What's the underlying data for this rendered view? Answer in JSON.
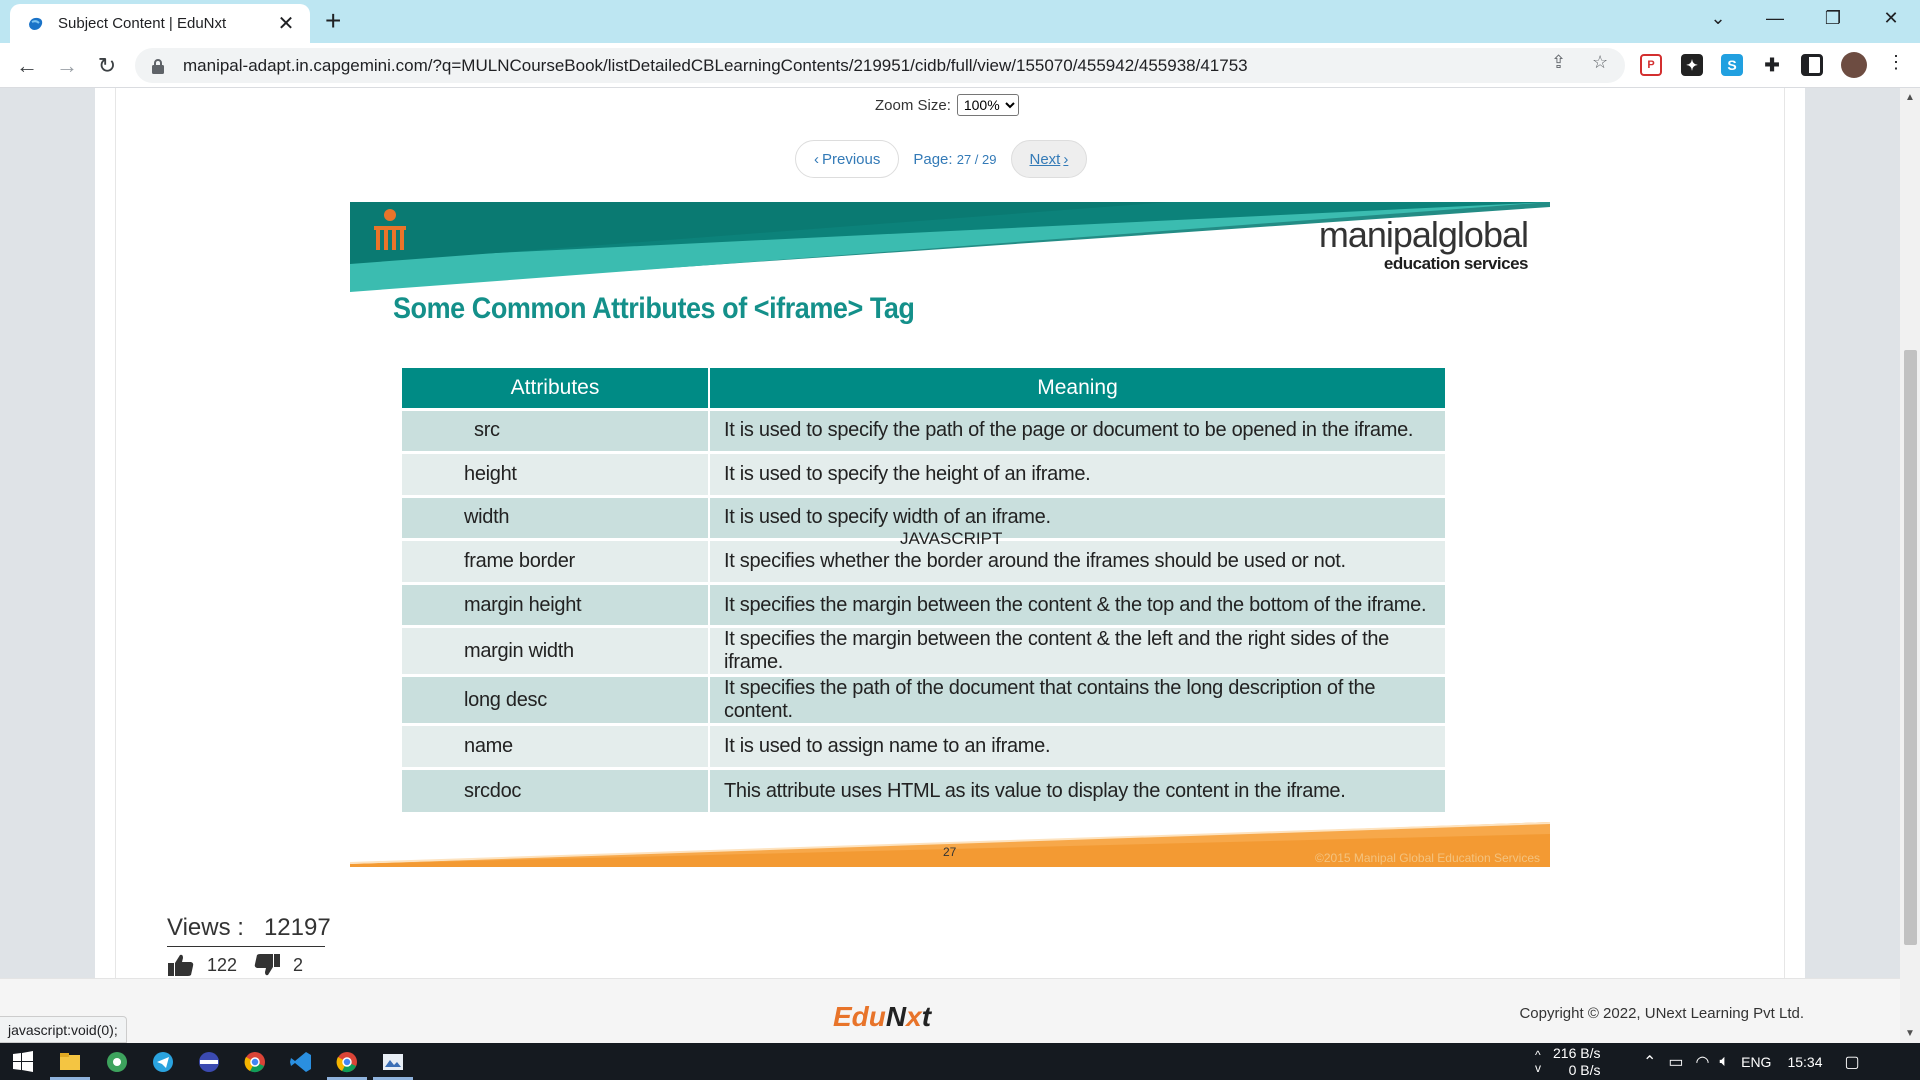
{
  "browser": {
    "tab_title": "Subject Content | EduNxt",
    "url": "manipal-adapt.in.capgemini.com/?q=MULNCourseBook/listDetailedCBLearningContents/219951/cidb/full/view/155070/455942/455938/41753"
  },
  "viewer": {
    "zoom_label": "Zoom Size:",
    "zoom_value": "100%",
    "prev_label": "Previous",
    "page_label": "Page:",
    "page_value": "27 / 29",
    "next_label": "Next"
  },
  "slide": {
    "brand_name": "manipalglobal",
    "brand_sub": "education services",
    "title": "Some Common Attributes of <iframe> Tag",
    "columns": [
      "Attributes",
      "Meaning"
    ],
    "rows": [
      {
        "attr": "src",
        "meaning": "It is used to specify the path of the page or document to be opened in the iframe."
      },
      {
        "attr": "height",
        "meaning": "It is used to specify the height of an iframe."
      },
      {
        "attr": "width",
        "meaning": "It is used to specify width of an iframe."
      },
      {
        "attr": "frame border",
        "meaning": "It specifies whether the border around the iframes should be used or not."
      },
      {
        "attr": "margin height",
        "meaning": "It specifies the margin between the content & the top and the bottom of the iframe."
      },
      {
        "attr": "margin width",
        "meaning": "It specifies the margin between the content & the left and the right sides of the iframe."
      },
      {
        "attr": "long desc",
        "meaning": "It specifies the path of the document that contains the long description of the content."
      },
      {
        "attr": "name",
        "meaning": "It is used to assign name to an iframe."
      },
      {
        "attr": "srcdoc",
        "meaning": "This attribute uses HTML as its value to display the content in the iframe."
      }
    ],
    "watermark": "JAVASCRIPT",
    "slide_number": "27",
    "slide_copyright": "©2015 Manipal Global Education Services"
  },
  "stats": {
    "views_label": "Views :",
    "views_value": "12197",
    "likes": "122",
    "dislikes": "2"
  },
  "footer": {
    "logo_a": "Edu",
    "logo_b": "N",
    "logo_c": "x",
    "logo_d": "t",
    "copyright": "Copyright © 2022, UNext Learning Pvt Ltd.",
    "status": "javascript:void(0);"
  },
  "taskbar": {
    "net_up": "216 B/s",
    "net_down": "0 B/s",
    "lang": "ENG",
    "time": "15:34"
  },
  "colors": {
    "teal": "#008b85",
    "orange": "#f7a84a",
    "link": "#337ab7"
  }
}
